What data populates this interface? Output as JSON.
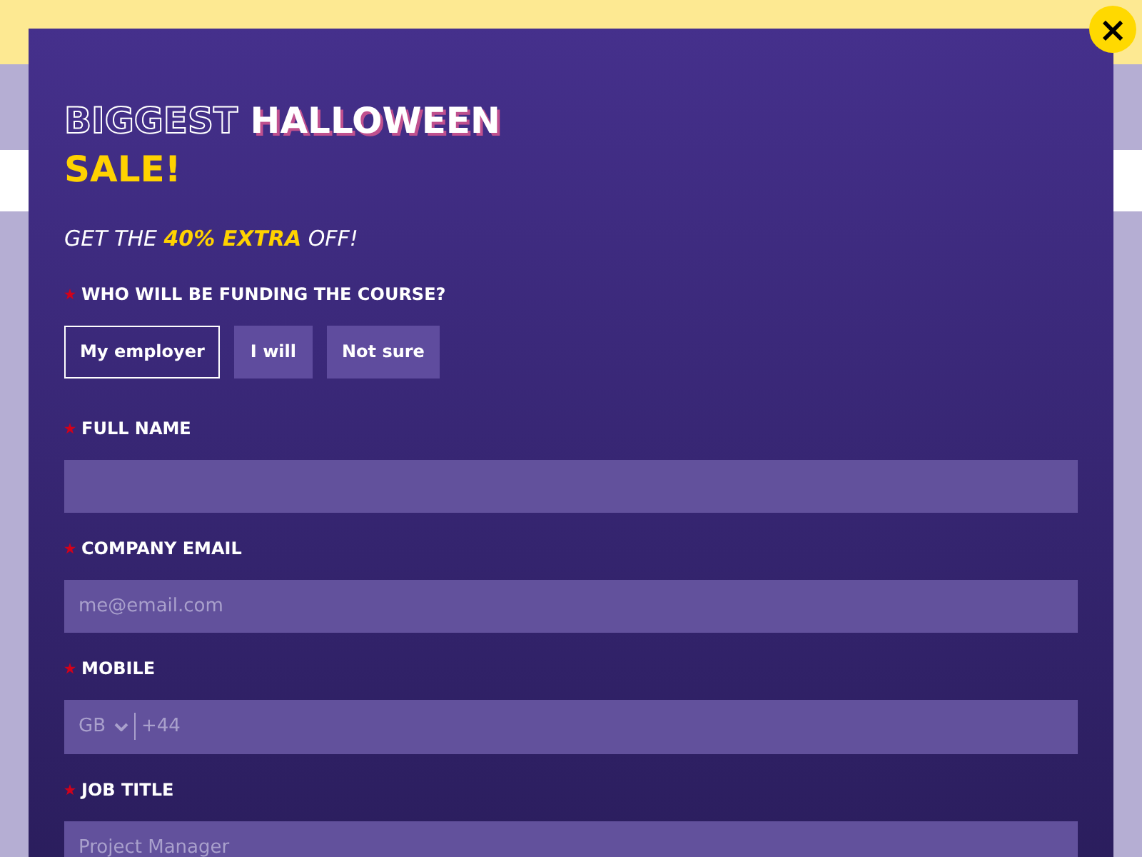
{
  "close_button": {
    "label": "×"
  },
  "heading": {
    "outline": "BIGGEST",
    "filled": "HALLOWEEN",
    "accent": "SALE!"
  },
  "subtitle": {
    "before": "GET THE",
    "highlight": "40% EXTRA",
    "after": "OFF!"
  },
  "funding": {
    "required": true,
    "label": "WHO WILL BE FUNDING THE COURSE?",
    "options": [
      {
        "label": "My employer",
        "selected": true
      },
      {
        "label": "I will",
        "selected": false
      },
      {
        "label": "Not sure",
        "selected": false
      }
    ]
  },
  "fields": [
    {
      "kind": "text",
      "required": true,
      "label": "FULL NAME"
    },
    {
      "kind": "text",
      "required": true,
      "label": "COMPANY EMAIL",
      "placeholder": "me@email.com"
    },
    {
      "kind": "phone",
      "required": true,
      "label": "MOBILE",
      "country": "GB",
      "placeholder": "+44"
    },
    {
      "kind": "text",
      "required": true,
      "label": "JOB TITLE",
      "placeholder": "Project Manager"
    }
  ]
}
